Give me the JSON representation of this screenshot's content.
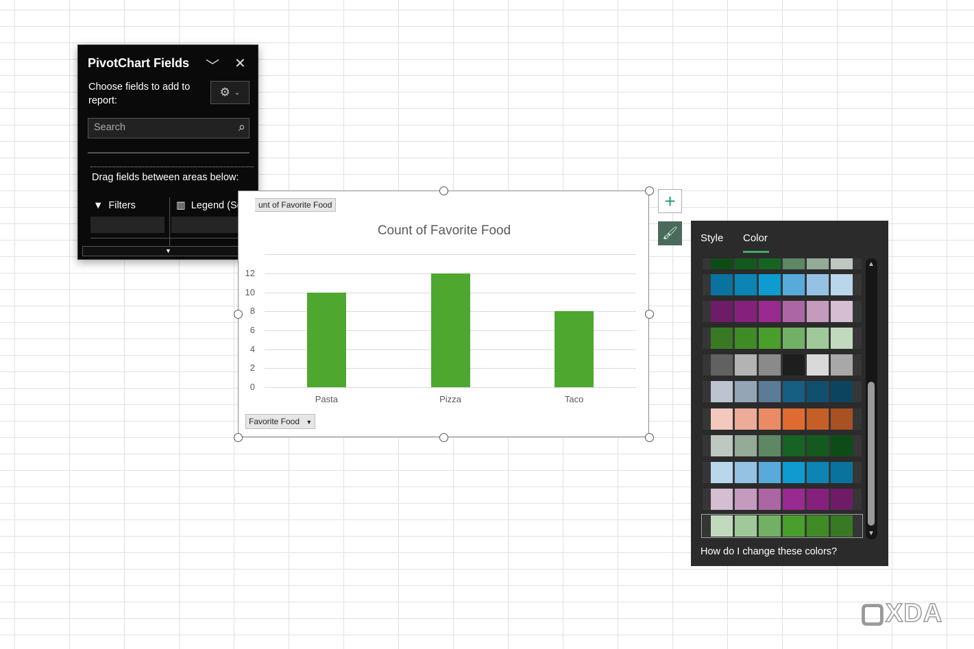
{
  "pane": {
    "title": "PivotChart Fields",
    "choose": "Choose fields to add to report:",
    "search_placeholder": "Search",
    "drag": "Drag fields between areas below:",
    "filters": "Filters",
    "legend": "Legend (Se..."
  },
  "chart_data": {
    "type": "bar",
    "title": "Count of Favorite Food",
    "categories": [
      "Pasta",
      "Pizza",
      "Taco"
    ],
    "values": [
      10,
      12,
      8
    ],
    "yticks": [
      0,
      2,
      4,
      6,
      8,
      10,
      12
    ],
    "ylim": [
      0,
      14
    ],
    "color": "#4ea72e",
    "value_field_button": "unt of Favorite Food",
    "axis_field_button": "Favorite Food"
  },
  "panel": {
    "tabs": [
      "Style",
      "Color"
    ],
    "active_tab": "Color",
    "help": "How do I change these colors?",
    "palettes": [
      [
        "#0e4c17",
        "#145a1f",
        "#176323",
        "#5e8763",
        "#94ab97",
        "#bec8c0"
      ],
      [
        "#0a729e",
        "#0c85b5",
        "#0e9bd0",
        "#58aadb",
        "#95c2e3",
        "#bad6eb"
      ],
      [
        "#6e1c67",
        "#85217c",
        "#992a90",
        "#ad66a4",
        "#c49abd",
        "#d5bdd2"
      ],
      [
        "#387a23",
        "#3f8c27",
        "#4a9e2b",
        "#72b165",
        "#a0c99a",
        "#c1dabd"
      ],
      [
        "#616161",
        "#b3b3b3",
        "#8a8a8a",
        "#1e1e1e",
        "#d9d9d9",
        "#a8a8a8"
      ],
      [
        "#bbc4cf",
        "#94a5b5",
        "#5b7b96",
        "#155e84",
        "#114f6f",
        "#0c4460"
      ],
      [
        "#f3c9bd",
        "#eeac98",
        "#ea8b66",
        "#e06b31",
        "#c55f28",
        "#a95122"
      ],
      [
        "#bec8c0",
        "#94ab97",
        "#5e8763",
        "#176323",
        "#145a1f",
        "#0e4c17"
      ],
      [
        "#bad6eb",
        "#95c2e3",
        "#58aadb",
        "#0e9bd0",
        "#0c85b5",
        "#0a729e"
      ],
      [
        "#d5bdd2",
        "#c49abd",
        "#ad66a4",
        "#992a90",
        "#85217c",
        "#6e1c67"
      ],
      [
        "#c1dabd",
        "#a0c99a",
        "#72b165",
        "#4a9e2b",
        "#3f8c27",
        "#387a23"
      ]
    ],
    "selected_palette": 10
  },
  "watermark": "XDA"
}
